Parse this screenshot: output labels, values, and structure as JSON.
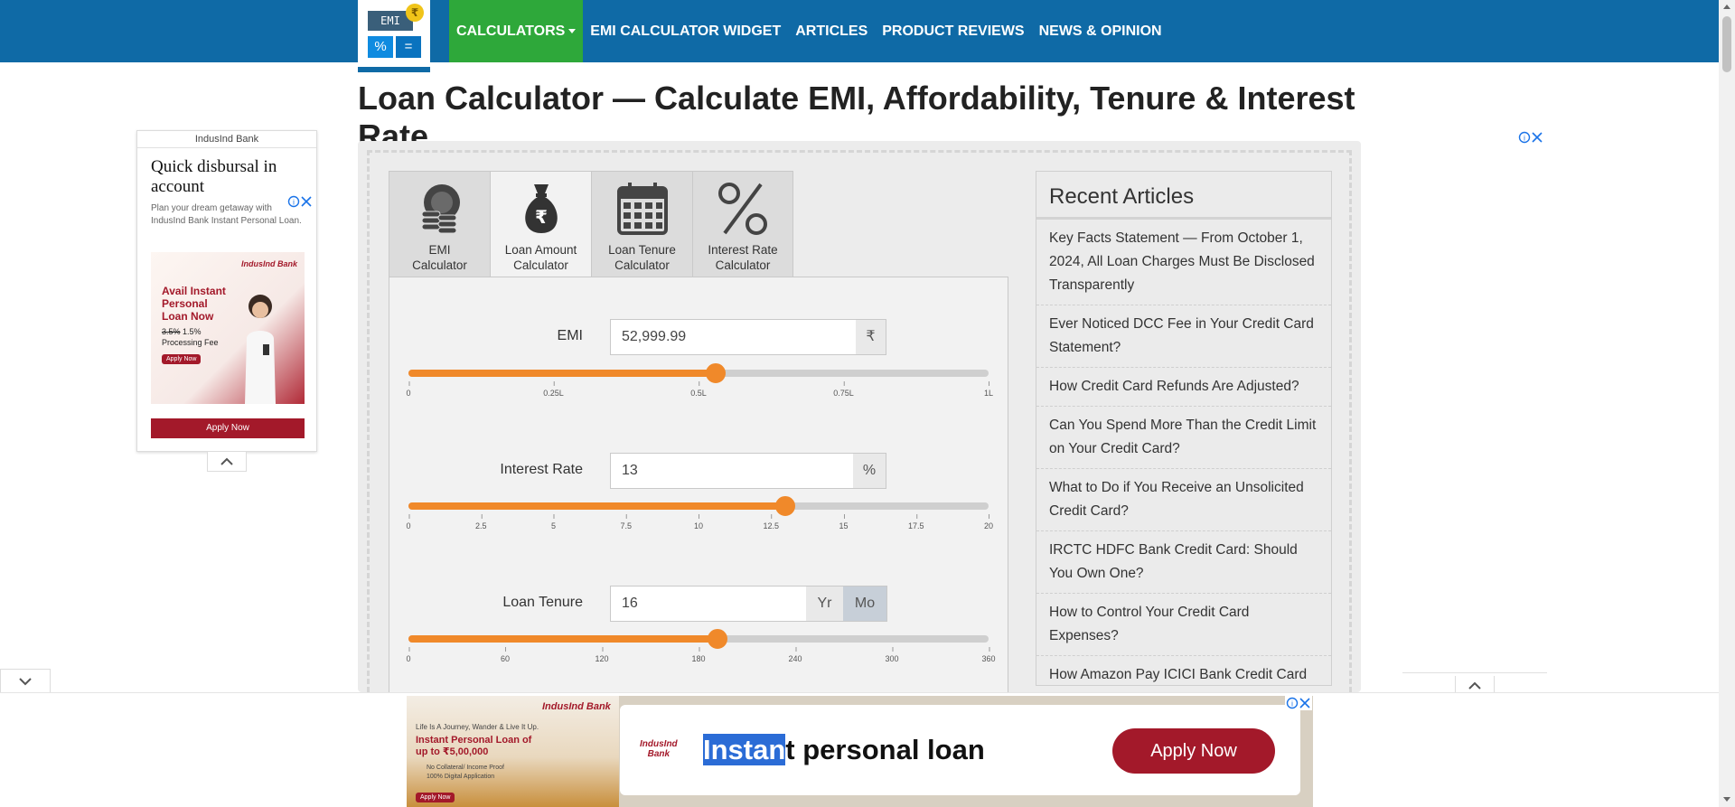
{
  "header": {
    "logo": {
      "screen_text": "EMI",
      "coin_text": "₹",
      "key1": "%",
      "key2": "="
    },
    "nav": [
      {
        "label": "CALCULATORS",
        "active": true,
        "dropdown": true
      },
      {
        "label": "EMI CALCULATOR WIDGET"
      },
      {
        "label": "ARTICLES"
      },
      {
        "label": "PRODUCT REVIEWS"
      },
      {
        "label": "NEWS & OPINION"
      }
    ]
  },
  "page_title": "Loan Calculator — Calculate EMI, Affordability, Tenure & Interest Rate",
  "tabs": [
    {
      "line1": "EMI",
      "line2": "Calculator",
      "icon": "coins-icon"
    },
    {
      "line1": "Loan Amount",
      "line2": "Calculator",
      "icon": "money-bag-icon",
      "active": true
    },
    {
      "line1": "Loan Tenure",
      "line2": "Calculator",
      "icon": "calendar-icon"
    },
    {
      "line1": "Interest Rate",
      "line2": "Calculator",
      "icon": "percent-icon"
    }
  ],
  "form": {
    "emi": {
      "label": "EMI",
      "value": "52,999.99",
      "addon": "₹",
      "slider_fraction": 0.53,
      "ticks": [
        "0",
        "0.25L",
        "0.5L",
        "0.75L",
        "1L"
      ]
    },
    "interest": {
      "label": "Interest Rate",
      "value": "13",
      "addon": "%",
      "slider_fraction": 0.65,
      "ticks": [
        "0",
        "2.5",
        "5",
        "7.5",
        "10",
        "12.5",
        "15",
        "17.5",
        "20"
      ]
    },
    "tenure": {
      "label": "Loan Tenure",
      "value": "16",
      "addon_yr": "Yr",
      "addon_mo": "Mo",
      "selected_unit": "Mo",
      "slider_fraction": 0.533,
      "ticks": [
        "0",
        "60",
        "120",
        "180",
        "240",
        "300",
        "360"
      ]
    }
  },
  "recent": {
    "title": "Recent Articles",
    "items": [
      "Key Facts Statement — From October 1, 2024, All Loan Charges Must Be Disclosed Transparently",
      "Ever Noticed DCC Fee in Your Credit Card Statement?",
      "How Credit Card Refunds Are Adjusted?",
      "Can You Spend More Than the Credit Limit on Your Credit Card?",
      "What to Do if You Receive an Unsolicited Credit Card?",
      "IRCTC HDFC Bank Credit Card: Should You Own One?",
      "How to Control Your Credit Card Expenses?",
      "How Amazon Pay ICICI Bank Credit Card"
    ]
  },
  "left_ad": {
    "brand": "IndusInd Bank",
    "headline": "Quick disbursal in account",
    "desc": "Plan your dream getaway with IndusInd Bank Instant Personal Loan.",
    "creative_brand": "IndusInd Bank",
    "creative_title": "Avail Instant Personal Loan Now",
    "fee_old": "3.5%",
    "fee_new": "1.5%",
    "fee_text": "Processing Fee",
    "creative_button": "Apply Now",
    "apply": "Apply Now"
  },
  "bottom_ad": {
    "creative_tagline": "Life Is A Journey, Wander & Live It Up.",
    "creative_title": "Instant Personal Loan of up to ₹5,00,000",
    "creative_points": "No Collateral/ Income Proof\n100% Digital Application",
    "creative_brand": "IndusInd Bank",
    "creative_button": "Apply Now",
    "card_brand_line1": "IndusInd",
    "card_brand_line2": "Bank",
    "headline_highlight": "Instan",
    "headline_rest": "t personal loan",
    "apply": "Apply Now"
  },
  "colors": {
    "header_bg": "#0f6aa6",
    "nav_active": "#2ea83a",
    "slider_accent": "#f0892a",
    "ad_brand": "#a3192a"
  }
}
